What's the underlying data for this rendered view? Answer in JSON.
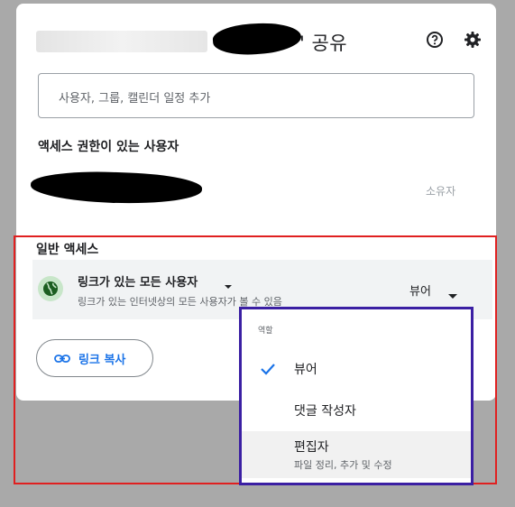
{
  "dialog": {
    "title_suffix": "' 공유",
    "search": {
      "placeholder": "사용자, 그룹, 캘린더 일정 추가"
    },
    "people_section": {
      "title": "액세스 권한이 있는 사용자",
      "owner_role": "소유자"
    },
    "general_access": {
      "title": "일반 액세스",
      "selected_option": "링크가 있는 모든 사용자",
      "description": "링크가 있는 인터넷상의 모든 사용자가 볼 수 있음",
      "role": "뷰어"
    },
    "copy_link_label": "링크 복사"
  },
  "role_menu": {
    "header": "역할",
    "items": [
      {
        "label": "뷰어",
        "checked": true
      },
      {
        "label": "댓글 작성자"
      },
      {
        "label": "편집자",
        "description": "파일 정리, 추가 및 수정"
      }
    ]
  },
  "colors": {
    "accent": "#1a73e8",
    "highlight_red": "#e02020",
    "highlight_purple": "#3b1fa3",
    "globe_bg": "#c8e6c9"
  }
}
